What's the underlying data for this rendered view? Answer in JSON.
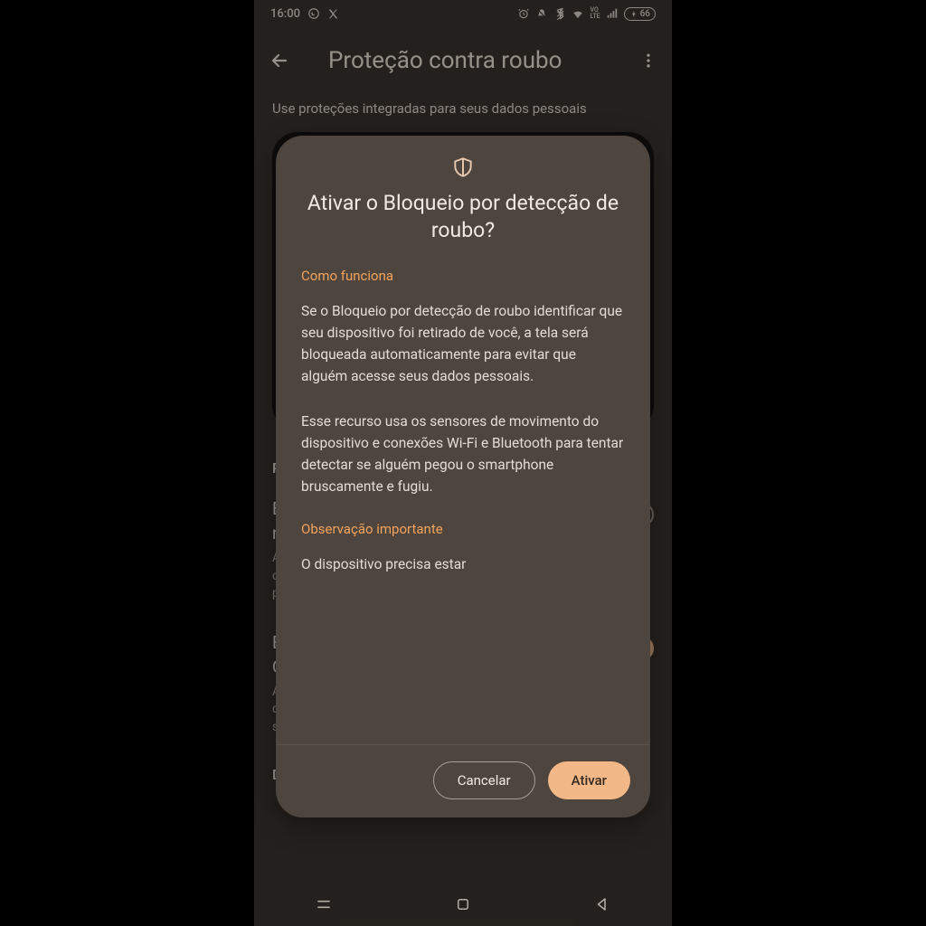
{
  "statusbar": {
    "time": "16:00",
    "battery": "66"
  },
  "appbar": {
    "title": "Proteção contra roubo"
  },
  "page": {
    "description": "Use proteções integradas para seus dados pessoais",
    "section1_header": "P",
    "setting1": {
      "title_line1": "B",
      "title_line2": "r",
      "sub": "A\nc\np"
    },
    "setting2": {
      "title_line1": "B",
      "title_line2": "C",
      "sub_line1": "A",
      "sub_line2": "dispositivo ficar off-line para proteger",
      "sub_line3": "seus dados"
    },
    "section2_header": "Dispositivo protegido remotamente"
  },
  "dialog": {
    "title": "Ativar o Bloqueio por detecção de roubo?",
    "how_heading": "Como funciona",
    "para1": "Se o Bloqueio por detecção de roubo identificar que seu dispositivo foi retirado de você, a tela será bloqueada automaticamente para evitar que alguém acesse seus dados pessoais.",
    "para2": "Esse recurso usa os sensores de movimento do dispositivo e conexões Wi-Fi e Bluetooth para tentar detectar se alguém pegou o smartphone bruscamente e fugiu.",
    "note_heading": "Observação importante",
    "para3": "O dispositivo precisa estar",
    "cancel": "Cancelar",
    "confirm": "Ativar"
  }
}
